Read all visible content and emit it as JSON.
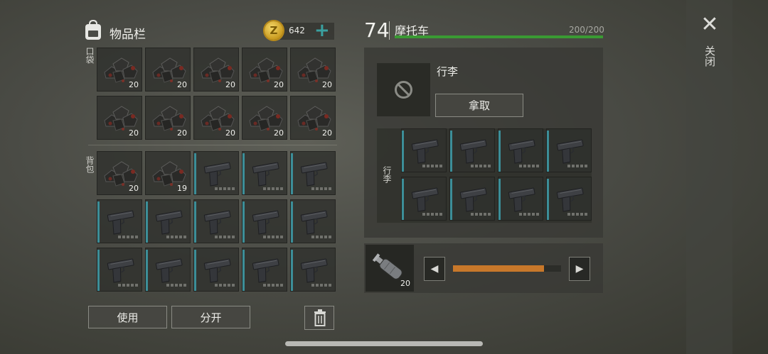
{
  "inventory": {
    "title": "物品栏",
    "money": "642",
    "pocket_label": "口袋",
    "backpack_label": "背包",
    "pocket_slots": [
      {
        "item": "coal-ore",
        "count": "20"
      },
      {
        "item": "coal-ore",
        "count": "20"
      },
      {
        "item": "coal-ore",
        "count": "20"
      },
      {
        "item": "coal-ore",
        "count": "20"
      },
      {
        "item": "coal-ore",
        "count": "20"
      },
      {
        "item": "coal-ore",
        "count": "20"
      },
      {
        "item": "coal-ore",
        "count": "20"
      },
      {
        "item": "coal-ore",
        "count": "20"
      },
      {
        "item": "coal-ore",
        "count": "20"
      },
      {
        "item": "coal-ore",
        "count": "20"
      }
    ],
    "backpack_slots": [
      {
        "item": "coal-ore",
        "count": "20"
      },
      {
        "item": "coal-ore",
        "count": "19"
      },
      {
        "item": "pistol",
        "count": ""
      },
      {
        "item": "pistol",
        "count": ""
      },
      {
        "item": "pistol",
        "count": ""
      },
      {
        "item": "pistol",
        "count": ""
      },
      {
        "item": "pistol",
        "count": ""
      },
      {
        "item": "pistol",
        "count": ""
      },
      {
        "item": "pistol",
        "count": ""
      },
      {
        "item": "pistol",
        "count": ""
      },
      {
        "item": "pistol",
        "count": ""
      },
      {
        "item": "pistol",
        "count": ""
      },
      {
        "item": "pistol",
        "count": ""
      },
      {
        "item": "pistol",
        "count": ""
      },
      {
        "item": "pistol",
        "count": ""
      }
    ],
    "use_label": "使用",
    "split_label": "分开"
  },
  "vehicle": {
    "level": "74",
    "name": "摩托车",
    "hp": "200/200",
    "hp_fraction": 1.0,
    "luggage_label": "行李",
    "take_label": "拿取",
    "luggage_side_label": "行李",
    "luggage_slots": [
      "pistol",
      "pistol",
      "pistol",
      "pistol",
      "pistol",
      "pistol",
      "pistol",
      "pistol"
    ],
    "fuel_count": "20",
    "fuel_fraction": 0.84
  },
  "close_label": "关闭",
  "colors": {
    "hp_bar": "#3a9a33",
    "fuel_bar": "#c8782a",
    "durability_bar": "#3c8e98",
    "accent_plus": "#3aa0a0"
  }
}
